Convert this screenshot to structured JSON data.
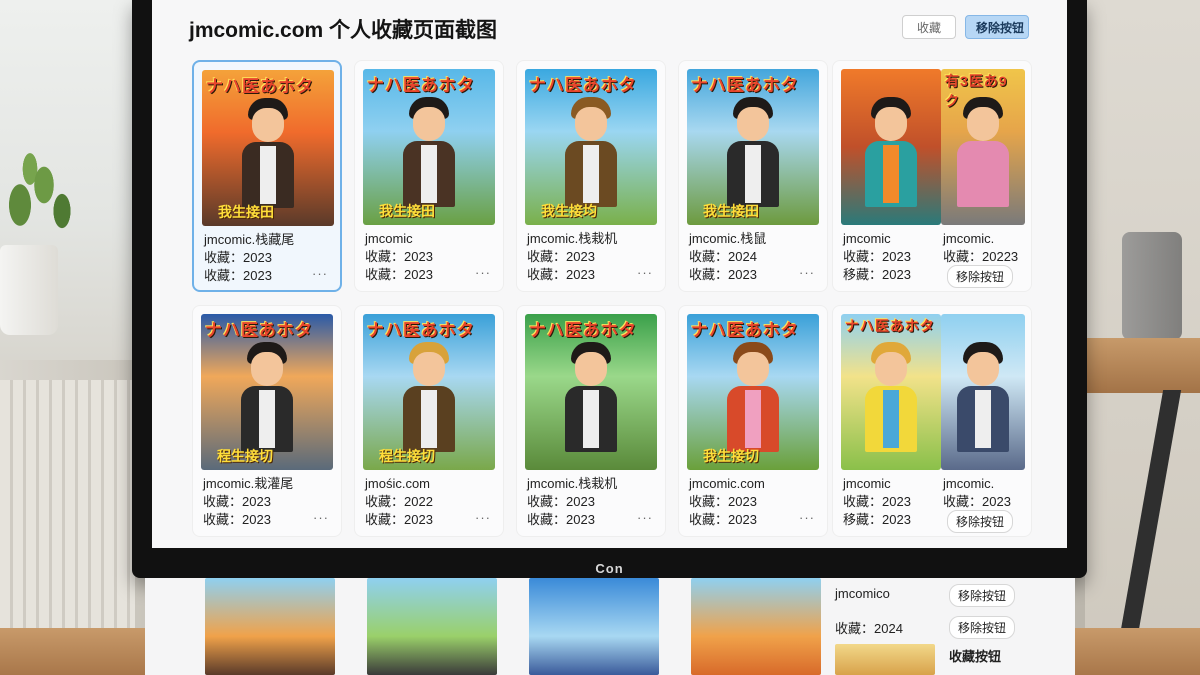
{
  "page": {
    "title": "jmcomic.com 个人收藏页面截图",
    "buttons": {
      "favorites": "收藏",
      "remove": "移除按钮"
    },
    "monitor_brand": "Con"
  },
  "cards": [
    {
      "cover_title": "ナハ医あホタ",
      "cover_sub": "我生接田",
      "name": "jmcomic.栈藏尾",
      "line2": "收藏：2023",
      "line3": "收藏：2023",
      "more": "···",
      "selected": true
    },
    {
      "cover_title": "ナハ医あホタ",
      "cover_sub": "我生接田",
      "name": "jmcomic",
      "line2": "收藏：2023",
      "line3": "收藏：2023",
      "more": "···"
    },
    {
      "cover_title": "ナハ医あホタ",
      "cover_sub": "我生接均",
      "name": "jmcomic.栈栽机",
      "line2": "收藏：2023",
      "line3": "收藏：2023",
      "more": "···"
    },
    {
      "cover_title": "ナハ医あホタ",
      "cover_sub": "我生接田",
      "name": "jmcomic.栈鼠",
      "line2": "收藏：2024",
      "line3": "收藏：2023",
      "more": "···"
    },
    {
      "cover_title": "",
      "cover2_title": "有3医あ9ク",
      "name": "jmcomic",
      "name2": "jmcomic.",
      "line2": "收藏：2023",
      "line2b": "收藏：20223",
      "line3": "移藏：2023",
      "pill": "移除按钮"
    },
    {
      "cover_title": "ナハ医あホタ",
      "cover_sub": "程生接切",
      "name": "jmcomic.栽灌尾",
      "line2": "收藏：2023",
      "line3": "收藏：2023",
      "more": "···"
    },
    {
      "cover_title": "ナハ医あホタ",
      "cover_sub": "程生接切",
      "name": "jmośic.com",
      "line2": "收藏：2022",
      "line3": "收藏：2023",
      "more": "···"
    },
    {
      "cover_title": "ナハ医あホタ",
      "cover_sub": "",
      "name": "jmcomic.栈栽机",
      "line2": "收藏：2023",
      "line3": "收藏：2023",
      "more": "···"
    },
    {
      "cover_title": "ナハ医あホタ",
      "cover_sub": "我生接切",
      "name": "jmcomic.com",
      "line2": "收藏：2023",
      "line3": "收藏：2023",
      "more": "···"
    },
    {
      "cover_title": "ナハ医あホタ",
      "name": "jmcomic",
      "name2": "jmcomic.",
      "line2": "收藏：2023",
      "line2b": "收藏：2023",
      "line3": "移藏：2023",
      "pill": "移除按钮"
    }
  ],
  "lower": {
    "name": "jmcomico",
    "date": "收藏：2024",
    "pill1": "移除按钮",
    "pill2": "移除按钮",
    "label": "收藏按钮"
  },
  "colors": {
    "accent": "#6fb1e8",
    "remove_button_bg": "#b7d7f5",
    "cover_title": "#e8452c",
    "cover_subtitle": "#ffde3a"
  }
}
